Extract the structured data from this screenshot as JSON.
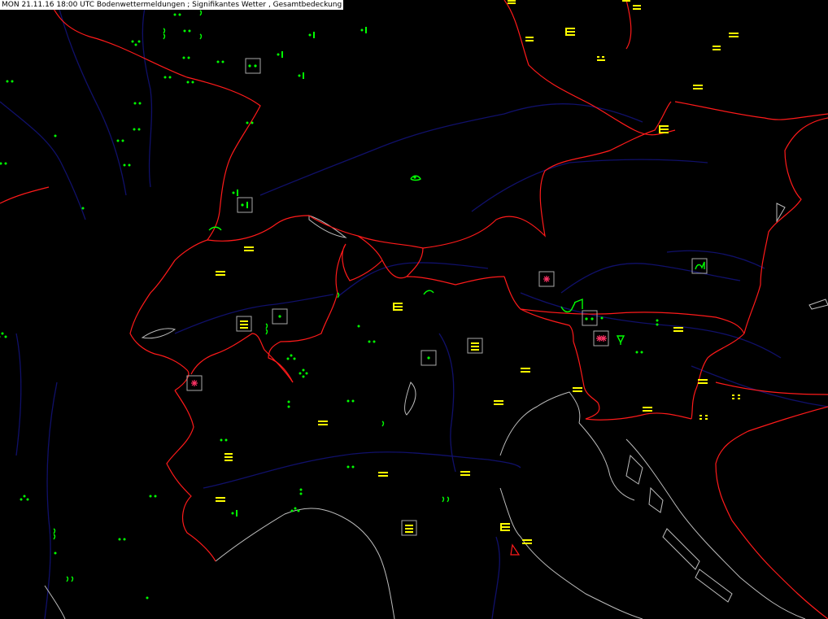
{
  "header": {
    "title": "MON 21.11.16 18:00 UTC  Bodenwettermeldungen ;  Signifikantes Wetter , Gesamtbedeckung"
  },
  "colors": {
    "background": "#000000",
    "border": "#ff0000",
    "river": "#000080",
    "coast": "#c0c0c0",
    "rain": "#00ff00",
    "fog": "#ffff00",
    "snow": "#ff3366",
    "box": "#b0b0b0"
  },
  "legend_symbols": {
    "rain": "dot-cluster",
    "fog": "horizontal-bars",
    "snow": "asterisk",
    "thunder": "bracket-hook"
  }
}
